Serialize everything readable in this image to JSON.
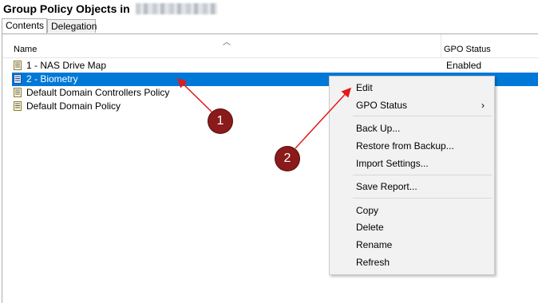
{
  "header": {
    "title": "Group Policy Objects in"
  },
  "tabs": [
    {
      "label": "Contents"
    },
    {
      "label": "Delegation"
    }
  ],
  "columns": {
    "name": "Name",
    "status": "GPO Status"
  },
  "rows": [
    {
      "name": "1 - NAS Drive Map",
      "status": "Enabled"
    },
    {
      "name": "2 - Biometry",
      "status": ""
    },
    {
      "name": "Default Domain Controllers Policy",
      "status": ""
    },
    {
      "name": "Default Domain Policy",
      "status": ""
    }
  ],
  "context_menu": {
    "items": [
      {
        "label": "Edit"
      },
      {
        "label": "GPO Status",
        "submenu_glyph": "›"
      },
      {
        "label": "Back Up..."
      },
      {
        "label": "Restore from Backup..."
      },
      {
        "label": "Import Settings..."
      },
      {
        "label": "Save Report..."
      },
      {
        "label": "Copy"
      },
      {
        "label": "Delete"
      },
      {
        "label": "Rename"
      },
      {
        "label": "Refresh"
      }
    ]
  },
  "annotations": [
    {
      "label": "1"
    },
    {
      "label": "2"
    }
  ],
  "colors": {
    "selection": "#0078d7",
    "annotation": "#e01b1b",
    "badge": "#8b1a1a"
  },
  "icons": {
    "gpo": "gpo-document-icon",
    "sort": "sort-ascending-icon"
  }
}
